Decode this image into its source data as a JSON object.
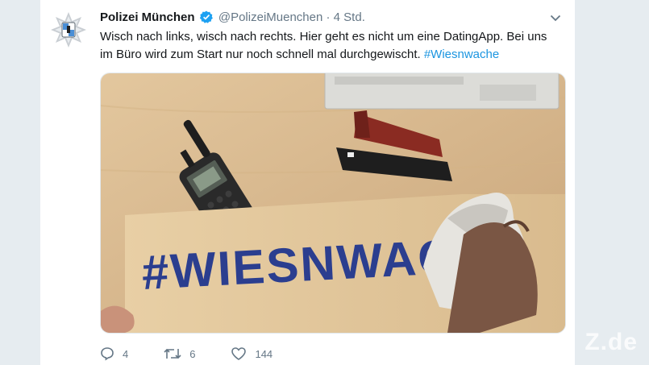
{
  "tweet": {
    "author_name": "Polizei München",
    "handle": "@PolizeiMuenchen",
    "separator": "·",
    "time": "4 Std.",
    "text": "Wisch nach links, wisch nach rechts. Hier geht es nicht um eine DatingApp. Bei uns im Büro wird zum Start nur noch schnell mal durchgewischt.",
    "hashtag": "#Wiesnwache",
    "menu_icon": "chevron-down-icon",
    "verified_icon": "verified-badge-icon"
  },
  "media": {
    "sign_text": "#WIESNWACH",
    "colors": {
      "desk": "#d9b98e",
      "sign": "#e2c79c",
      "lettering": "#2b3e8f"
    }
  },
  "actions": {
    "reply_count": "4",
    "retweet_count": "6",
    "like_count": "144"
  },
  "watermark": "Z.de",
  "colors": {
    "accent": "#1b95e0",
    "secondary_text": "#657786",
    "page_bg": "#e6ecf0"
  }
}
